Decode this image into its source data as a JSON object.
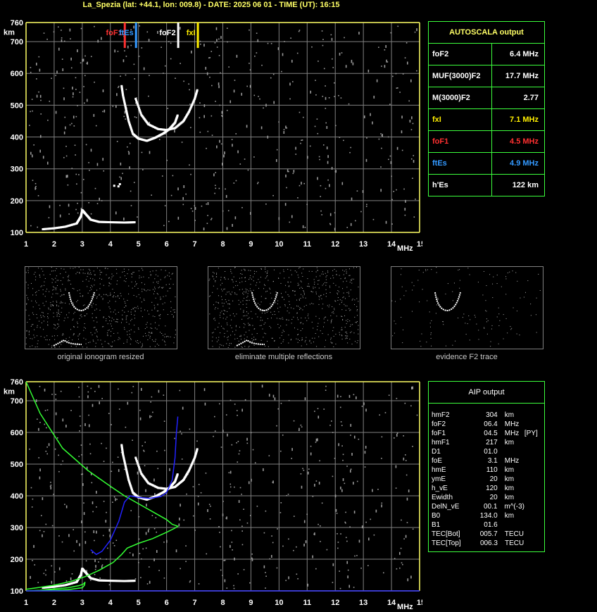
{
  "title": "La_Spezia (lat: +44.1, lon: 009.8) - DATE: 2025 06 01 - TIME (UT): 16:15",
  "colors": {
    "axis": "#ffff66",
    "grid": "#808080",
    "trace": "#ffffff",
    "profile": "#33ff33",
    "model_trace": "#2222ff",
    "foF1": "#ff3030",
    "ftEs": "#3399ff",
    "fxI": "#ffee00"
  },
  "chart_data": [
    {
      "type": "scatter",
      "name": "main-ionogram",
      "xlabel": "MHz",
      "ylabel": "km",
      "xlim": [
        1,
        15
      ],
      "ylim": [
        100,
        760
      ],
      "x_ticks": [
        "1",
        "2",
        "3",
        "4",
        "5",
        "6",
        "7",
        "8",
        "9",
        "10",
        "11",
        "12",
        "13",
        "14",
        "15"
      ],
      "y_ticks": [
        "760",
        "700",
        "600",
        "500",
        "400",
        "300",
        "200",
        "100"
      ],
      "markers": [
        {
          "label": "foF1",
          "freq": 4.5,
          "color": "#ff3030"
        },
        {
          "label": "ftEs",
          "freq": 4.9,
          "color": "#3399ff"
        },
        {
          "label": "foF2",
          "freq": 6.4,
          "color": "#ffffff"
        },
        {
          "label": "fxI",
          "freq": 7.1,
          "color": "#ffee00"
        }
      ],
      "traces": {
        "E_trace": [
          [
            1.6,
            110
          ],
          [
            2.0,
            113
          ],
          [
            2.4,
            118
          ],
          [
            2.8,
            128
          ],
          [
            2.95,
            150
          ],
          [
            3.0,
            170
          ],
          [
            3.1,
            160
          ],
          [
            3.3,
            140
          ],
          [
            3.6,
            133
          ],
          [
            4.0,
            132
          ],
          [
            4.5,
            131
          ],
          [
            4.9,
            132
          ]
        ],
        "F_o_trace": [
          [
            4.4,
            560
          ],
          [
            4.45,
            530
          ],
          [
            4.55,
            490
          ],
          [
            4.65,
            450
          ],
          [
            4.8,
            410
          ],
          [
            5.0,
            395
          ],
          [
            5.3,
            388
          ],
          [
            5.6,
            398
          ],
          [
            5.9,
            412
          ],
          [
            6.1,
            425
          ],
          [
            6.3,
            445
          ],
          [
            6.4,
            470
          ]
        ],
        "F_x_trace": [
          [
            4.9,
            520
          ],
          [
            5.1,
            470
          ],
          [
            5.35,
            440
          ],
          [
            5.7,
            425
          ],
          [
            6.0,
            422
          ],
          [
            6.3,
            428
          ],
          [
            6.6,
            450
          ],
          [
            6.8,
            480
          ],
          [
            7.0,
            520
          ],
          [
            7.1,
            550
          ]
        ],
        "Es_points": [
          [
            4.1,
            250
          ],
          [
            4.25,
            248
          ],
          [
            4.3,
            255
          ]
        ]
      }
    },
    {
      "type": "line",
      "name": "aip-profile",
      "xlabel": "MHz",
      "ylabel": "km",
      "xlim": [
        1,
        15
      ],
      "ylim": [
        100,
        760
      ],
      "x_ticks": [
        "1",
        "2",
        "3",
        "4",
        "5",
        "6",
        "7",
        "8",
        "9",
        "10",
        "11",
        "12",
        "13",
        "14",
        "15"
      ],
      "y_ticks": [
        "760",
        "700",
        "600",
        "500",
        "400",
        "300",
        "200",
        "100"
      ],
      "series": [
        {
          "values": [
            [
              1.0,
              760
            ],
            [
              1.5,
              660
            ],
            [
              2.3,
              550
            ],
            [
              3.2,
              480
            ],
            [
              4.0,
              430
            ],
            [
              4.5,
              400
            ],
            [
              5.1,
              370
            ],
            [
              5.6,
              345
            ],
            [
              6.0,
              325
            ],
            [
              6.2,
              310
            ],
            [
              6.4,
              304
            ],
            [
              6.3,
              298
            ],
            [
              6.0,
              285
            ],
            [
              5.5,
              265
            ],
            [
              5.0,
              250
            ],
            [
              4.6,
              235
            ],
            [
              4.4,
              215
            ],
            [
              4.1,
              190
            ],
            [
              3.6,
              165
            ],
            [
              3.1,
              145
            ],
            [
              2.6,
              130
            ],
            [
              2.0,
              118
            ],
            [
              1.4,
              110
            ],
            [
              1.0,
              105
            ]
          ]
        },
        {
          "values": [
            [
              1.0,
              100
            ],
            [
              1.5,
              102
            ],
            [
              2.0,
              106
            ],
            [
              2.5,
              110
            ],
            [
              2.9,
              117
            ],
            [
              3.05,
              122
            ],
            [
              3.1,
              128
            ],
            [
              3.08,
              118
            ],
            [
              3.0,
              110
            ],
            [
              2.5,
              104
            ],
            [
              1.6,
              101
            ],
            [
              1.0,
              100
            ]
          ]
        },
        {
          "values": [
            [
              3.3,
              230
            ],
            [
              3.5,
              215
            ],
            [
              3.7,
              225
            ],
            [
              4.0,
              260
            ],
            [
              4.3,
              320
            ],
            [
              4.5,
              380
            ],
            [
              4.7,
              400
            ],
            [
              5.0,
              395
            ],
            [
              5.4,
              392
            ],
            [
              5.8,
              398
            ],
            [
              6.0,
              410
            ],
            [
              6.2,
              450
            ],
            [
              6.3,
              520
            ],
            [
              6.35,
              600
            ],
            [
              6.4,
              650
            ]
          ]
        }
      ]
    }
  ],
  "thumbnails": [
    {
      "caption": "original ionogram resized"
    },
    {
      "caption": "eliminate multiple reflections"
    },
    {
      "caption": "evidence F2 trace"
    }
  ],
  "autoscala": {
    "header": "AUTOSCALA output",
    "rows": [
      {
        "label": "foF2",
        "value": "6.4 MHz",
        "color": "#ffffff"
      },
      {
        "label": "MUF(3000)F2",
        "value": "17.7 MHz",
        "color": "#ffffff"
      },
      {
        "label": "M(3000)F2",
        "value": "2.77",
        "color": "#ffffff"
      },
      {
        "label": "fxI",
        "value": "7.1 MHz",
        "color": "#ffee00"
      },
      {
        "label": "foF1",
        "value": "4.5 MHz",
        "color": "#ff3030"
      },
      {
        "label": "ftEs",
        "value": "4.9 MHz",
        "color": "#3399ff"
      },
      {
        "label": "h'Es",
        "value": "122     km",
        "color": "#ffffff"
      }
    ]
  },
  "aip": {
    "header": "AIP output",
    "rows": [
      {
        "p": "hmF2",
        "v": "304",
        "u": "km",
        "f": ""
      },
      {
        "p": "foF2",
        "v": "06.4",
        "u": "MHz",
        "f": ""
      },
      {
        "p": "foF1",
        "v": "04.5",
        "u": "MHz",
        "f": "[PY]"
      },
      {
        "p": "hmF1",
        "v": "217",
        "u": "km",
        "f": ""
      },
      {
        "p": "D1",
        "v": "01.0",
        "u": "",
        "f": ""
      },
      {
        "p": "foE",
        "v": "3.1",
        "u": "MHz",
        "f": ""
      },
      {
        "p": "hmE",
        "v": "110",
        "u": "km",
        "f": ""
      },
      {
        "p": "ymE",
        "v": "20",
        "u": "km",
        "f": ""
      },
      {
        "p": "h_vE",
        "v": "120",
        "u": "km",
        "f": ""
      },
      {
        "p": "Ewidth",
        "v": "20",
        "u": "km",
        "f": ""
      },
      {
        "p": "DelN_vE",
        "v": "00.1",
        "u": "m^(-3)",
        "f": ""
      },
      {
        "p": "B0",
        "v": "134.0",
        "u": "km",
        "f": ""
      },
      {
        "p": "B1",
        "v": "01.6",
        "u": "",
        "f": ""
      },
      {
        "p": "TEC[Bot]",
        "v": "005.7",
        "u": "TECU",
        "f": ""
      },
      {
        "p": "TEC[Top]",
        "v": "006.3",
        "u": "TECU",
        "f": ""
      }
    ]
  }
}
